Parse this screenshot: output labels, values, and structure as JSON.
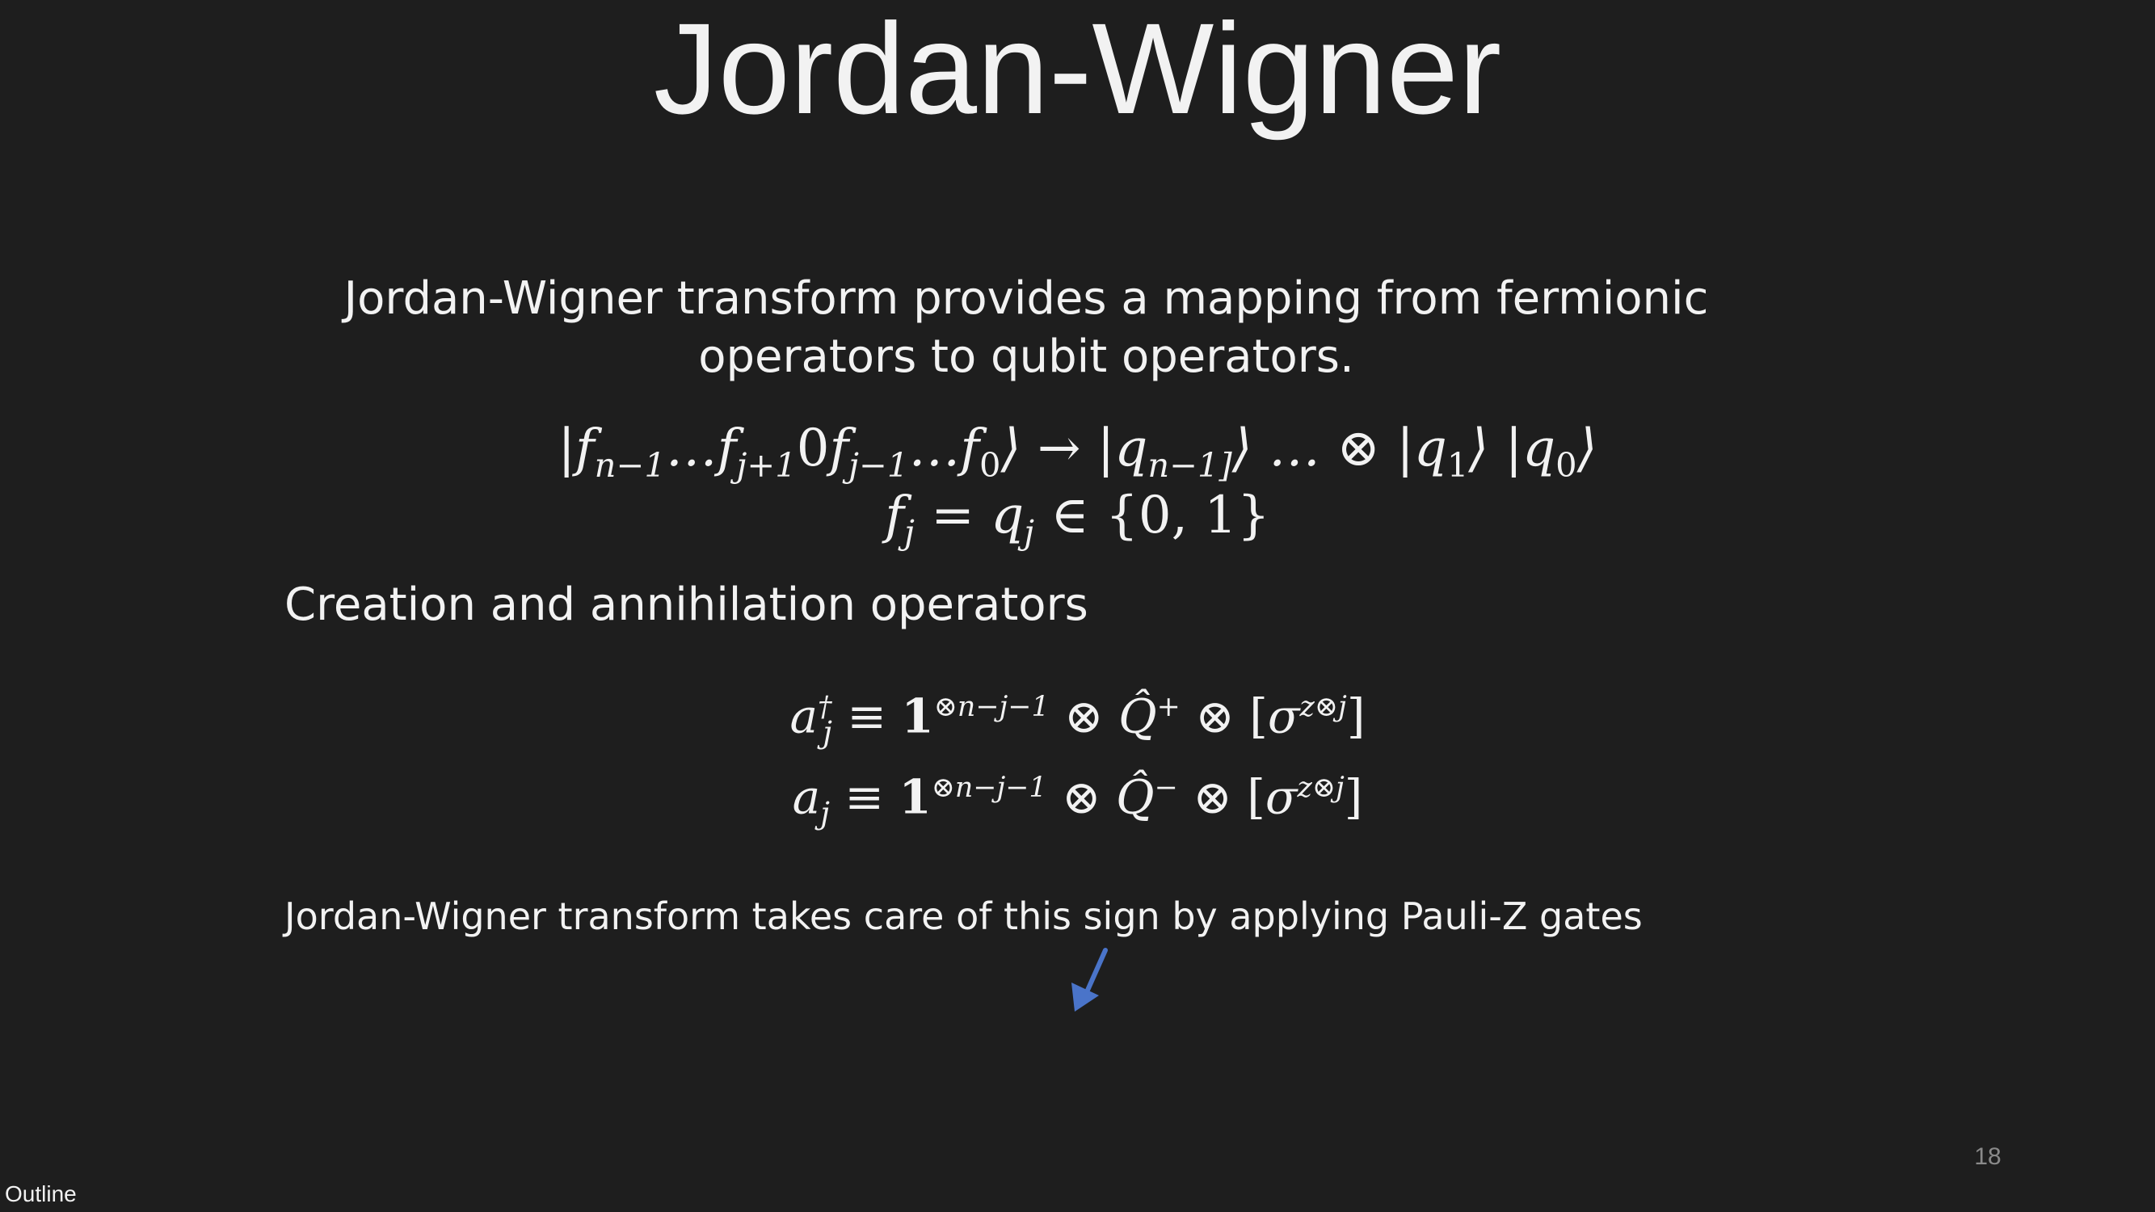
{
  "slide": {
    "title": "Jordan-Wigner",
    "intro_text": "Jordan-Wigner transform provides a mapping from fermionic operators to qubit operators.",
    "section_heading": "Creation and annihilation operators",
    "note_text": "Jordan-Wigner transform takes care of this sign by applying Pauli-Z gates",
    "page_number": "18",
    "outline_link": "Outline"
  },
  "colors": {
    "background": "#1e1e1e",
    "text": "#f2f2f2",
    "arrow": "#4a74c9",
    "page_number": "#8a8a8a"
  }
}
